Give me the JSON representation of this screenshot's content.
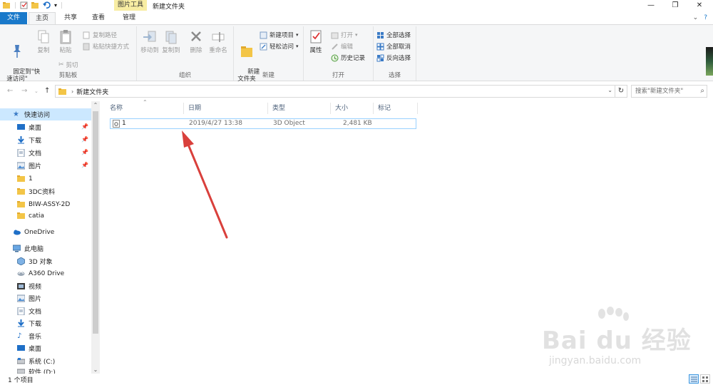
{
  "titlebar": {
    "tool_tab": "图片工具",
    "title": "新建文件夹",
    "controls": [
      "—",
      "❐",
      "✕"
    ]
  },
  "tabs": {
    "file": "文件",
    "home": "主页",
    "share": "共享",
    "view": "查看",
    "manage": "管理"
  },
  "ribbon": {
    "clipboard": {
      "label": "剪贴板",
      "pin_quick_access": "固定到\"快\n速访问\"",
      "copy": "复制",
      "paste": "粘贴",
      "copy_path": "复制路径",
      "paste_shortcut": "粘贴快捷方式",
      "cut": "剪切"
    },
    "organize": {
      "label": "组织",
      "move_to": "移动到",
      "copy_to": "复制到",
      "delete": "删除",
      "rename": "重命名"
    },
    "new": {
      "label": "新建",
      "new_folder": "新建\n文件夹",
      "new_item": "新建项目",
      "easy_access": "轻松访问"
    },
    "open": {
      "label": "打开",
      "properties": "属性",
      "open": "打开",
      "edit": "编辑",
      "history": "历史记录"
    },
    "select": {
      "label": "选择",
      "select_all": "全部选择",
      "select_none": "全部取消",
      "invert": "反向选择"
    }
  },
  "address": {
    "crumb": "新建文件夹",
    "search_placeholder": "搜索\"新建文件夹\""
  },
  "nav": {
    "quick_access": "快速访问",
    "quick_items": [
      {
        "label": "桌面",
        "pinned": true
      },
      {
        "label": "下载",
        "pinned": true
      },
      {
        "label": "文档",
        "pinned": true
      },
      {
        "label": "图片",
        "pinned": true
      },
      {
        "label": "1",
        "pinned": false
      },
      {
        "label": "3DC资料",
        "pinned": false
      },
      {
        "label": "BIW-ASSY-2D",
        "pinned": false
      },
      {
        "label": "catia",
        "pinned": false
      }
    ],
    "onedrive": "OneDrive",
    "this_pc": "此电脑",
    "pc_items": [
      "3D 对象",
      "A360 Drive",
      "视频",
      "图片",
      "文档",
      "下载",
      "音乐",
      "桌面",
      "系统 (C:)",
      "软件 (D:)"
    ]
  },
  "columns": [
    "名称",
    "日期",
    "类型",
    "大小",
    "标记"
  ],
  "files": [
    {
      "name": "1",
      "date": "2019/4/27 13:38",
      "type": "3D Object",
      "size": "2,481 KB"
    }
  ],
  "status": {
    "count": "1 个项目"
  },
  "watermark": {
    "brand": "Bai du 经验",
    "url": "jingyan.baidu.com"
  },
  "colors": {
    "file_tab": "#1979ca",
    "tool_tab": "#f8eda3",
    "selection": "#cce8ff",
    "annotation_arrow": "#d9403c"
  }
}
